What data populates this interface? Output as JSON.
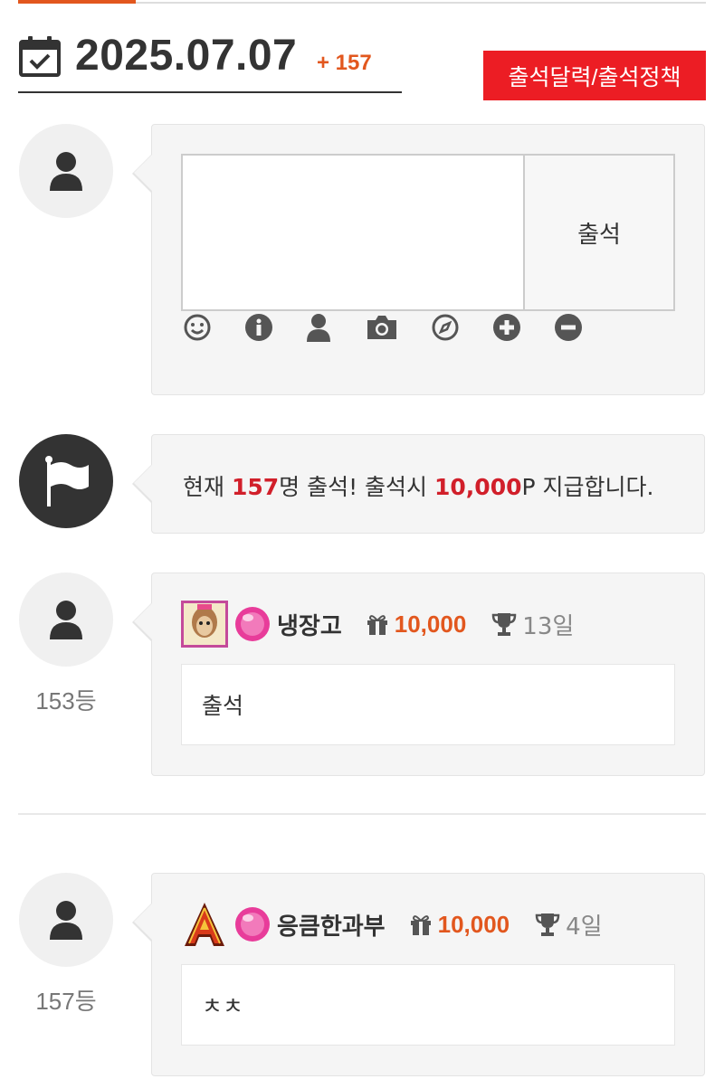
{
  "header": {
    "date": "2025.07.07",
    "count": "+ 157",
    "policy_button": "출석달력/출석정책"
  },
  "write": {
    "submit_label": "출석",
    "tools": [
      "smile-icon",
      "info-icon",
      "user-icon",
      "camera-icon",
      "compass-icon",
      "plus-icon",
      "minus-icon"
    ]
  },
  "notice": {
    "prefix": "현재 ",
    "count": "157",
    "middle": "명 출석! 출석시 ",
    "points": "10,000",
    "suffix": "P 지급합니다."
  },
  "entries": [
    {
      "rank": "153등",
      "nick": "냉장고",
      "points": "10,000",
      "days": "13일",
      "comment": "출석"
    },
    {
      "rank": "157등",
      "nick": "응큼한과부",
      "points": "10,000",
      "days": "4일",
      "comment": "ㅊㅊ"
    }
  ],
  "colors": {
    "accent": "#e2571e",
    "red_button": "#ec1d24",
    "highlight": "#d11f2a"
  }
}
